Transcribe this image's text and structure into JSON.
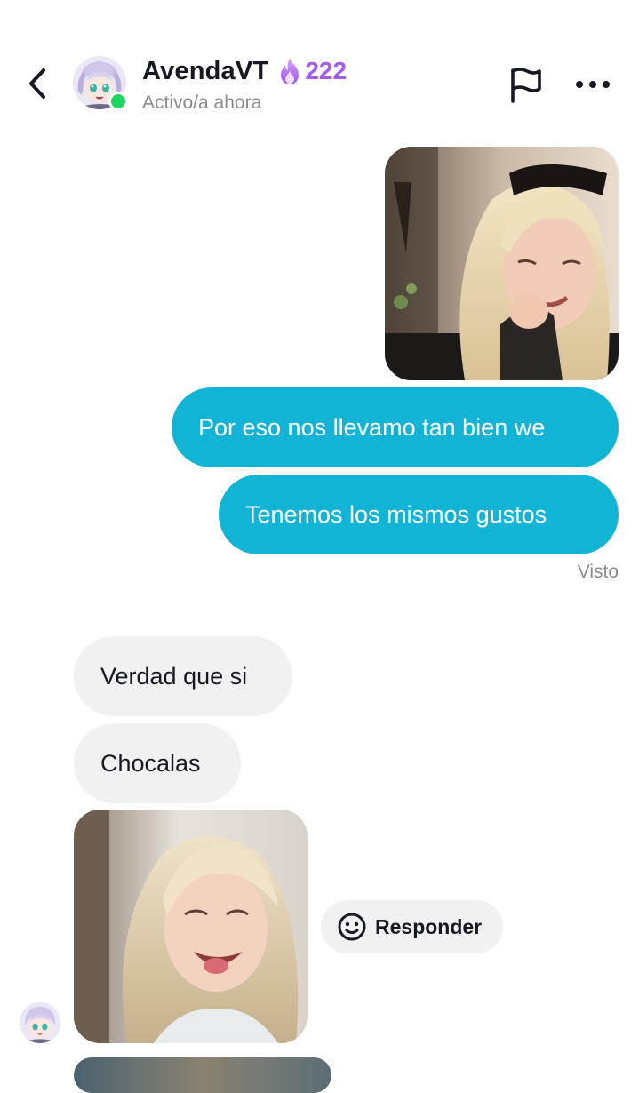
{
  "header": {
    "back_icon": "chevron-left-icon",
    "username": "AvendaVT",
    "streak_icon": "flame-icon",
    "streak_count": "222",
    "status": "Activo/a ahora",
    "flag_icon": "flag-icon",
    "more_icon": "more-horizontal-icon",
    "colors": {
      "streak": "#a65ce8",
      "online": "#1ed760"
    }
  },
  "messages": {
    "sent_photo": "photo",
    "sent_1": "Por eso nos llevamo tan bien we",
    "sent_2": "Tenemos los mismos gustos",
    "seen": "Visto",
    "received_1": "Verdad que si",
    "received_2": "Chocalas",
    "received_photo": "photo",
    "reply_icon": "smiley-icon",
    "reply_label": "Responder"
  },
  "colors": {
    "sent_bubble": "#11b4d4",
    "received_bubble": "#f1f1f2",
    "muted_text": "#8a8b91"
  }
}
